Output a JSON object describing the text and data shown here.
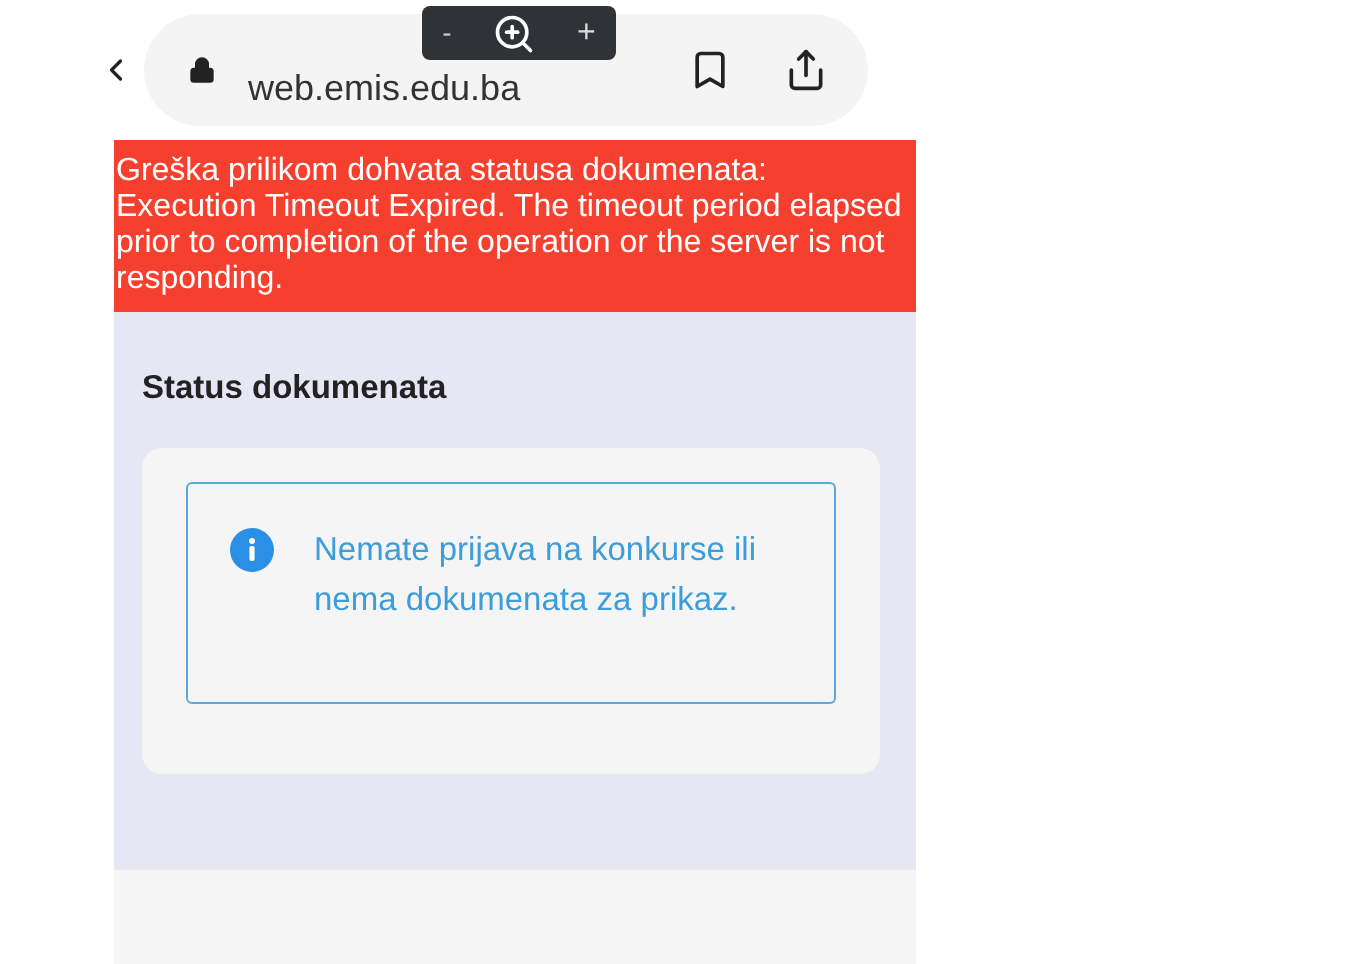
{
  "browser": {
    "url": "web.emis.edu.ba",
    "zoom_controls": {
      "minus": "-",
      "plus": "+"
    }
  },
  "error_banner": "Greška prilikom dohvata statusa dokumenata: Execution Timeout Expired. The timeout period elapsed prior to completion of the operation or the server is not responding.",
  "section": {
    "title": "Status dokumenata",
    "alert": "Nemate prijava na konkurse ili nema dokumenata za prikaz."
  }
}
